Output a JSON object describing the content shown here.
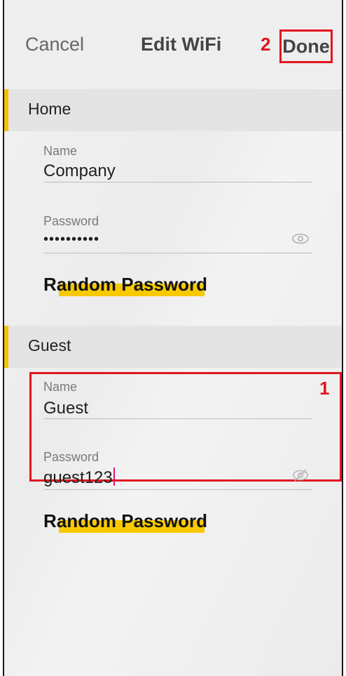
{
  "header": {
    "cancel_label": "Cancel",
    "title": "Edit WiFi",
    "done_label": "Done",
    "done_step": "2"
  },
  "home": {
    "section_label": "Home",
    "name_label": "Name",
    "name_value": "Company",
    "password_label": "Password",
    "password_value": "••••••••••",
    "random_label": "Random Password",
    "eye_icon": "eye-icon"
  },
  "guest": {
    "section_label": "Guest",
    "step": "1",
    "name_label": "Name",
    "name_value": "Guest",
    "password_label": "Password",
    "password_value": "guest123",
    "random_label": "Random Password",
    "eye_icon": "eye-off-icon"
  },
  "colors": {
    "accent": "#f2c200",
    "highlight": "#f7c900",
    "annotation": "#e0151f"
  }
}
